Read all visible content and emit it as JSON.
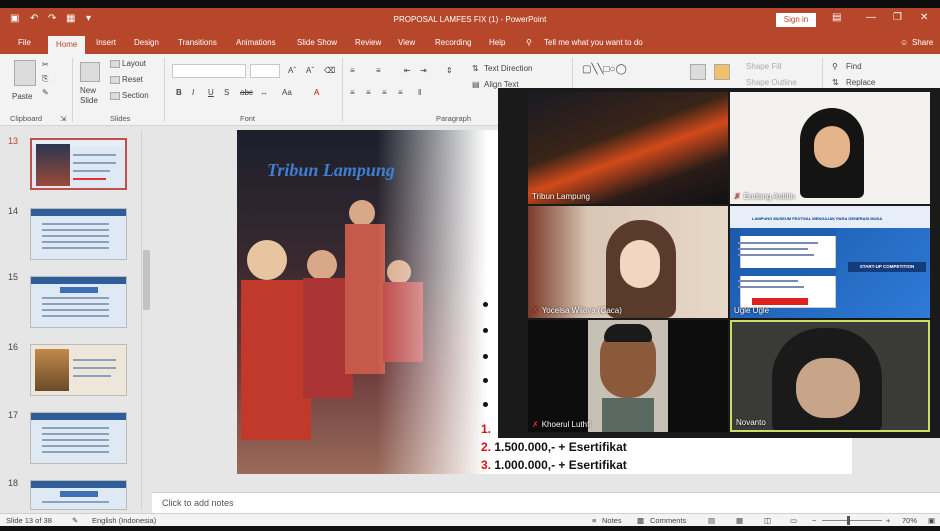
{
  "window": {
    "title": "PROPOSAL LAMFES FIX (1)  -  PowerPoint",
    "sign_in": "Sign in",
    "share": "Share"
  },
  "tabs": [
    "File",
    "Home",
    "Insert",
    "Design",
    "Transitions",
    "Animations",
    "Slide Show",
    "Review",
    "View",
    "Recording",
    "Help"
  ],
  "tell_me": "Tell me what you want to do",
  "ribbon": {
    "paste": "Paste",
    "new_slide": "New Slide",
    "layout": "Layout",
    "reset": "Reset",
    "section": "Section",
    "font_sample": "Aa",
    "text_direction": "Text Direction",
    "align_text": "Align Text",
    "shape_fill": "Shape Fill",
    "shape_outline": "Shape Outline",
    "find": "Find",
    "replace": "Replace",
    "groups": {
      "clipboard": "Clipboard",
      "slides": "Slides",
      "font": "Font",
      "paragraph": "Paragraph"
    }
  },
  "thumbnails": [
    {
      "num": "13",
      "selected": true
    },
    {
      "num": "14",
      "selected": false
    },
    {
      "num": "15",
      "selected": false
    },
    {
      "num": "16",
      "selected": false
    },
    {
      "num": "17",
      "selected": false
    },
    {
      "num": "18",
      "selected": false
    }
  ],
  "slide": {
    "logo_text": "Tribun Lampung",
    "prizes": [
      {
        "num": "1.",
        "text": ""
      },
      {
        "num": "2.",
        "text": "1.500.000,- + Esertifikat"
      },
      {
        "num": "3.",
        "text": "1.000.000,- + Esertifikat"
      }
    ]
  },
  "notes_placeholder": "Click to add notes",
  "status": {
    "slide_counter": "Slide 13 of 38",
    "language": "English (Indonesia)",
    "notes": "Notes",
    "comments": "Comments",
    "zoom": "70%"
  },
  "meeting": {
    "participants": [
      {
        "name": "Tribun Lampung",
        "muted": false
      },
      {
        "name": "Endang Astitin",
        "muted": true
      },
      {
        "name": "Yocelsa Wijaya (Caca)",
        "muted": true
      },
      {
        "name": "Ugle Ugle",
        "muted": false
      },
      {
        "name": "Khoerul Luthfi",
        "muted": true
      },
      {
        "name": "Novanto",
        "muted": false
      }
    ],
    "poster": {
      "title": "LAMPUNG MUSEUM FESTIVAL MENGAJAK PARA GENERASI MUDA",
      "start_up": "START-UP COMPETITION"
    }
  },
  "colors": {
    "brand": "#b7472a",
    "active_speaker": "#c9de6a",
    "prize_number": "#dd1111"
  }
}
